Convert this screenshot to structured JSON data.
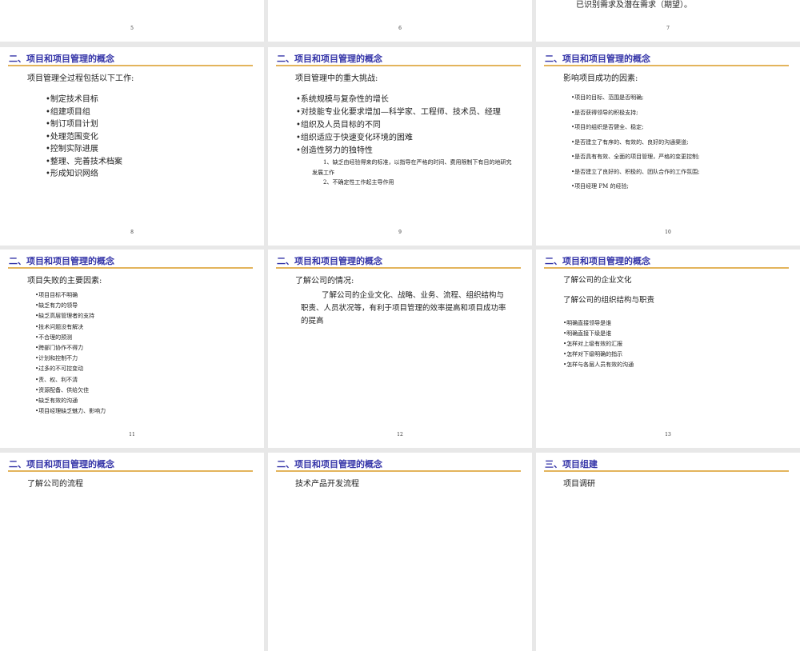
{
  "slides": [
    {
      "number": "5"
    },
    {
      "number": "6"
    },
    {
      "number": "7",
      "text": "已识别需求及潜在需求（期望）。"
    },
    {
      "number": "8",
      "title": "二、项目和项目管理的概念",
      "intro": "项目管理全过程包括以下工作:",
      "items": [
        "制定技术目标",
        "组建项目组",
        "制订项目计划",
        "处理范围变化",
        "控制实际进展",
        "整理、完善技术档案",
        "形成知识网络"
      ]
    },
    {
      "number": "9",
      "title": "二、项目和项目管理的概念",
      "intro": "项目管理中的重大挑战:",
      "items": [
        "系统规模与复杂性的增长",
        "对技能专业化要求增加—科学家、工程师、技术员、经理",
        "组织及人员目标的不同",
        "组织适应于快速变化环境的困难",
        "创造性努力的独特性"
      ],
      "subitems": [
        "1、缺乏由经验得来的标准，以指导在严格的时间、费用限制下有目的地研究发展工作",
        "2、不确定性工作起主导作用"
      ]
    },
    {
      "number": "10",
      "title": "二、项目和项目管理的概念",
      "intro": "影响项目成功的因素:",
      "items": [
        "项目的目标、范围是否明确;",
        "是否获得领导的积极支持;",
        "项目的组织是否健全、稳定;",
        "是否建立了有序的、有效的、良好的沟通渠道;",
        "是否具有有效、全面的项目管理，严格的变更控制;",
        "是否建立了良好的、积极的、团队合作的工作氛围;",
        "项目经理 PM 的经验;"
      ]
    },
    {
      "number": "11",
      "title": "二、项目和项目管理的概念",
      "intro": "项目失败的主要因素:",
      "items": [
        "项目目标不明确",
        "缺乏有力的领导",
        "缺乏高层管理者的支持",
        "技术问题没有解决",
        "不合理的预测",
        "跨部门协作不得力",
        "计划和控制不力",
        "过多的不可控变动",
        "责、权、利不清",
        "资源配备、供给欠佳",
        "缺乏有效的沟通",
        "项目经理缺乏魅力、影响力"
      ]
    },
    {
      "number": "12",
      "title": "二、项目和项目管理的概念",
      "intro": "了解公司的情况:",
      "paragraph": "了解公司的企业文化、战略、业务、流程、组织结构与职责、人员状况等，有利于项目管理的效率提高和项目成功率的提高"
    },
    {
      "number": "13",
      "title": "二、项目和项目管理的概念",
      "intro": "了解公司的企业文化",
      "intro2": "了解公司的组织结构与职责",
      "items": [
        "明确直接领导是谁",
        "明确直接下级是谁",
        "怎样对上级有效的汇报",
        "怎样对下级明确的指示",
        "怎样与各层人员有效的沟通"
      ]
    },
    {
      "title": "二、项目和项目管理的概念",
      "intro": "了解公司的流程"
    },
    {
      "title": "二、项目和项目管理的概念",
      "intro": "技术产品开发流程"
    },
    {
      "title": "三、项目组建",
      "intro": "项目调研"
    }
  ]
}
